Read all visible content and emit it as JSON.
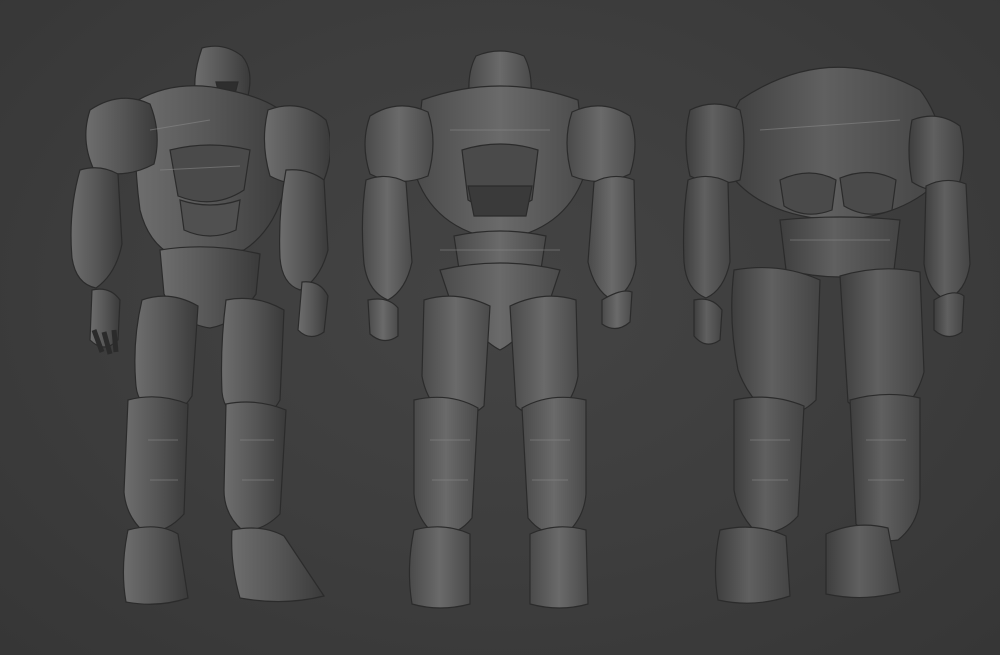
{
  "scene": {
    "background_color": "#3c3c3c",
    "material_color": "#5a5a5a",
    "highlight_color": "#8a8a8a",
    "shadow_color": "#2a2a2a",
    "views": [
      {
        "name": "three-quarter-front-view"
      },
      {
        "name": "front-view"
      },
      {
        "name": "back-view"
      }
    ]
  }
}
